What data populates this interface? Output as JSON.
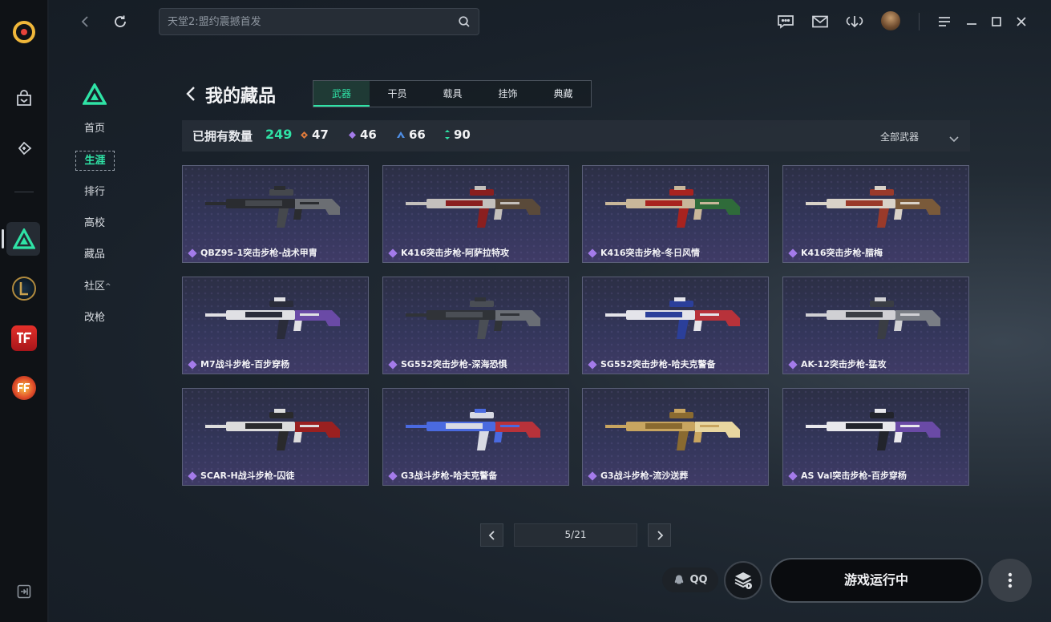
{
  "search": {
    "placeholder": "天堂2:盟约震撼首发"
  },
  "subnav": {
    "items": [
      {
        "label": "首页"
      },
      {
        "label": "生涯",
        "active": true
      },
      {
        "label": "排行"
      },
      {
        "label": "高校"
      },
      {
        "label": "藏品"
      },
      {
        "label": "社区",
        "suffix": "^"
      },
      {
        "label": "改枪"
      }
    ]
  },
  "header": {
    "title": "我的藏品",
    "tabs": [
      {
        "label": "武器",
        "active": true
      },
      {
        "label": "干员"
      },
      {
        "label": "载具"
      },
      {
        "label": "挂饰"
      },
      {
        "label": "典藏"
      }
    ]
  },
  "stats": {
    "label": "已拥有数量",
    "total": "249",
    "items": [
      {
        "value": "47",
        "color": "#e07a3a"
      },
      {
        "value": "46",
        "color": "#a47bea"
      },
      {
        "value": "66",
        "color": "#4f8fe6"
      },
      {
        "value": "90",
        "color": "#2fe3a6"
      }
    ],
    "filter": "全部武器"
  },
  "cards": [
    {
      "name": "QBZ95-1突击步枪-战术甲胄",
      "palette": [
        "#2a2c30",
        "#45484d",
        "#6b6e73"
      ]
    },
    {
      "name": "K416突击步枪-阿萨拉特攻",
      "palette": [
        "#c4c0bc",
        "#8a1f1f",
        "#5a4a3a"
      ]
    },
    {
      "name": "K416突击步枪-冬日风情",
      "palette": [
        "#c9b79a",
        "#a8231f",
        "#2f6b3a"
      ]
    },
    {
      "name": "K416突击步枪-腊梅",
      "palette": [
        "#d9d2c8",
        "#9a3a2a",
        "#7a5a3a"
      ]
    },
    {
      "name": "M7战斗步枪-百步穿杨",
      "palette": [
        "#e0e0e4",
        "#2a2c3a",
        "#6a4aa6"
      ]
    },
    {
      "name": "SG552突击步枪-深海恐惧",
      "palette": [
        "#303338",
        "#4a4e55",
        "#6a6e75"
      ]
    },
    {
      "name": "SG552突击步枪-哈夫克警备",
      "palette": [
        "#e4e4ea",
        "#2b3f9a",
        "#b8323a"
      ]
    },
    {
      "name": "AK-12突击步枪-猛攻",
      "palette": [
        "#d0d0d4",
        "#3a3d44",
        "#7a7e85"
      ]
    },
    {
      "name": "SCAR-H战斗步枪-囚徒",
      "palette": [
        "#dcdcdc",
        "#2a2a2c",
        "#9a2020"
      ]
    },
    {
      "name": "G3战斗步枪-哈夫克警备",
      "palette": [
        "#4a6ae0",
        "#d8dae4",
        "#b8323a"
      ]
    },
    {
      "name": "G3战斗步枪-流沙送葬",
      "palette": [
        "#c8a560",
        "#8a6a30",
        "#e8d6a0"
      ]
    },
    {
      "name": "AS Val突击步枪-百步穿杨",
      "palette": [
        "#e8e8ec",
        "#22242c",
        "#6a4aa6"
      ]
    }
  ],
  "pagination": {
    "text": "5/21"
  },
  "footer": {
    "qq_label": "QQ",
    "run_label": "游戏运行中"
  },
  "colors": {
    "accent": "#2fe3a6",
    "rarity_purple": "#a47bea"
  }
}
